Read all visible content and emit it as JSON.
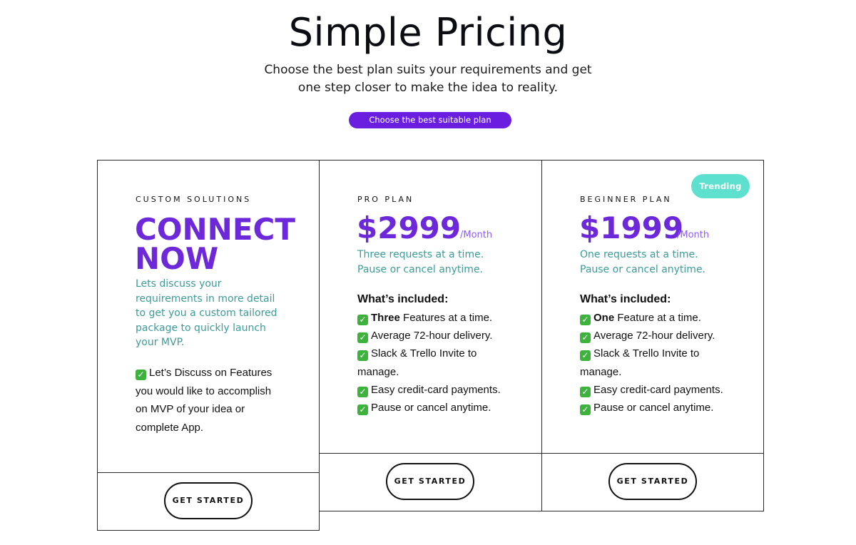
{
  "colors": {
    "accent_purple": "#6d28d9",
    "pill_purple": "#6a1fe0",
    "teal_text": "#3b9c97",
    "trending_teal": "#5ee0cf",
    "per_month": "#8b5cf6",
    "checkbox_green": "#3db33d"
  },
  "hero": {
    "title": "Simple Pricing",
    "subtitle_line1": "Choose the best plan suits your requirements and get",
    "subtitle_line2": "one step closer to make the idea to reality.",
    "pill_label": "Choose the best suitable plan"
  },
  "custom": {
    "label": "CUSTOM SOLUTIONS",
    "heading_line1": "CONNECT",
    "heading_line2": "NOW",
    "description_lines": [
      "Lets discuss your",
      "requirements in more detail",
      "to get you a custom tailored",
      "package to quickly launch",
      "your MVP."
    ],
    "feature_lines": [
      "Let’s Discuss on Features",
      "you would like to accomplish",
      "on MVP of your idea or",
      "complete App."
    ],
    "button_label": "GET STARTED"
  },
  "pro": {
    "label": "PRO PLAN",
    "price": "$2999",
    "period": "/Month",
    "note_line1": "Three requests at a time.",
    "note_line2": "Pause or cancel anytime.",
    "included_heading": "What’s included:",
    "features": [
      {
        "bold": "Three",
        "text": " Features at a time."
      },
      {
        "bold": "",
        "text": "Average 72-hour delivery."
      },
      {
        "bold": "",
        "text": "Slack & Trello Invite to"
      },
      {
        "bold": "",
        "text": "manage.",
        "no_check": true
      },
      {
        "bold": "",
        "text": "Easy credit-card payments."
      },
      {
        "bold": "",
        "text": "Pause or cancel anytime."
      }
    ],
    "button_label": "GET STARTED"
  },
  "beginner": {
    "label": "BEGINNER PLAN",
    "badge": "Trending",
    "price": "$1999",
    "period": "/Month",
    "note_line1": "One requests at a time.",
    "note_line2": "Pause or cancel anytime.",
    "included_heading": "What’s included:",
    "features": [
      {
        "bold": "One",
        "text": " Feature at a time."
      },
      {
        "bold": "",
        "text": "Average 72-hour delivery."
      },
      {
        "bold": "",
        "text": "Slack & Trello Invite to"
      },
      {
        "bold": "",
        "text": "manage.",
        "no_check": true
      },
      {
        "bold": "",
        "text": "Easy credit-card payments."
      },
      {
        "bold": "",
        "text": "Pause or cancel anytime."
      }
    ],
    "button_label": "GET STARTED"
  },
  "icons": {
    "checkbox": "check-mark-button-icon"
  }
}
